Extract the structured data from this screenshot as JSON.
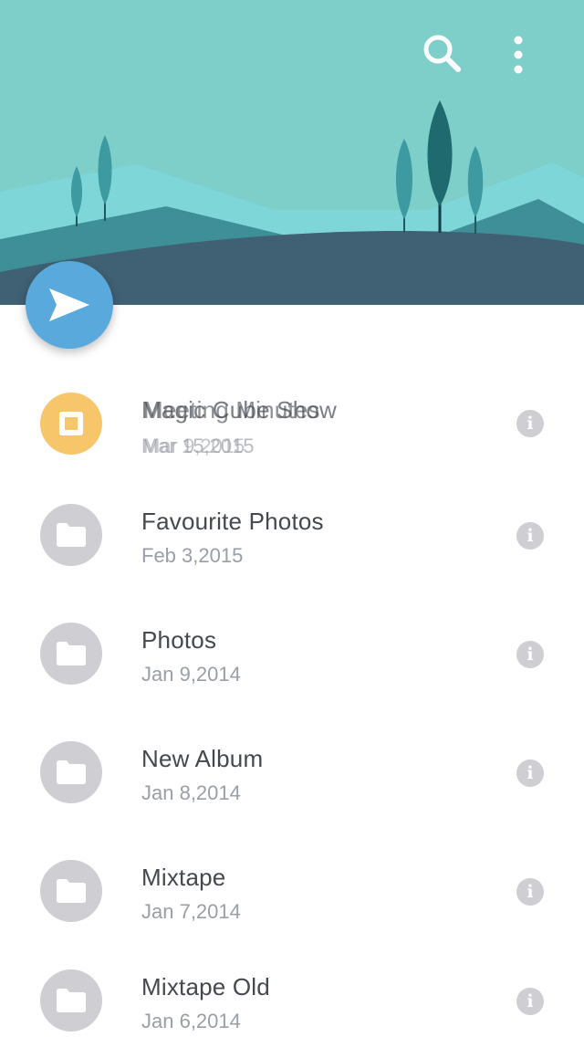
{
  "header": {
    "search_icon": "search-icon",
    "more_icon": "more-vertical-icon",
    "colors": {
      "sky": "#7ecfc9",
      "far_hills": "#7fd6d8",
      "mid_hill": "#3e8f98",
      "ground": "#406073",
      "tree_light": "#3c9aa0",
      "tree_dark": "#1f6a6e"
    }
  },
  "fab": {
    "icon": "send-icon",
    "color": "#5aa9dd"
  },
  "list": {
    "items": [
      {
        "title": "Meeting Minutes",
        "title_overlap_1": "Magic Cube Show",
        "title_overlap_2": "Meeting Minutes",
        "date": "Mar 9,2015",
        "date_overlap": "Mar 15,2015",
        "icon": "slideshow-icon",
        "highlight": true
      },
      {
        "title": "Favourite Photos",
        "date": "Feb 3,2015",
        "icon": "folder-icon"
      },
      {
        "title": "Photos",
        "date": "Jan 9,2014",
        "icon": "folder-icon"
      },
      {
        "title": "New Album",
        "date": "Jan 8,2014",
        "icon": "folder-icon"
      },
      {
        "title": "Mixtape",
        "date": "Jan 7,2014",
        "icon": "folder-icon"
      },
      {
        "title": "Mixtape Old",
        "date": "Jan 6,2014",
        "icon": "folder-icon"
      }
    ],
    "info_glyph": "i"
  }
}
